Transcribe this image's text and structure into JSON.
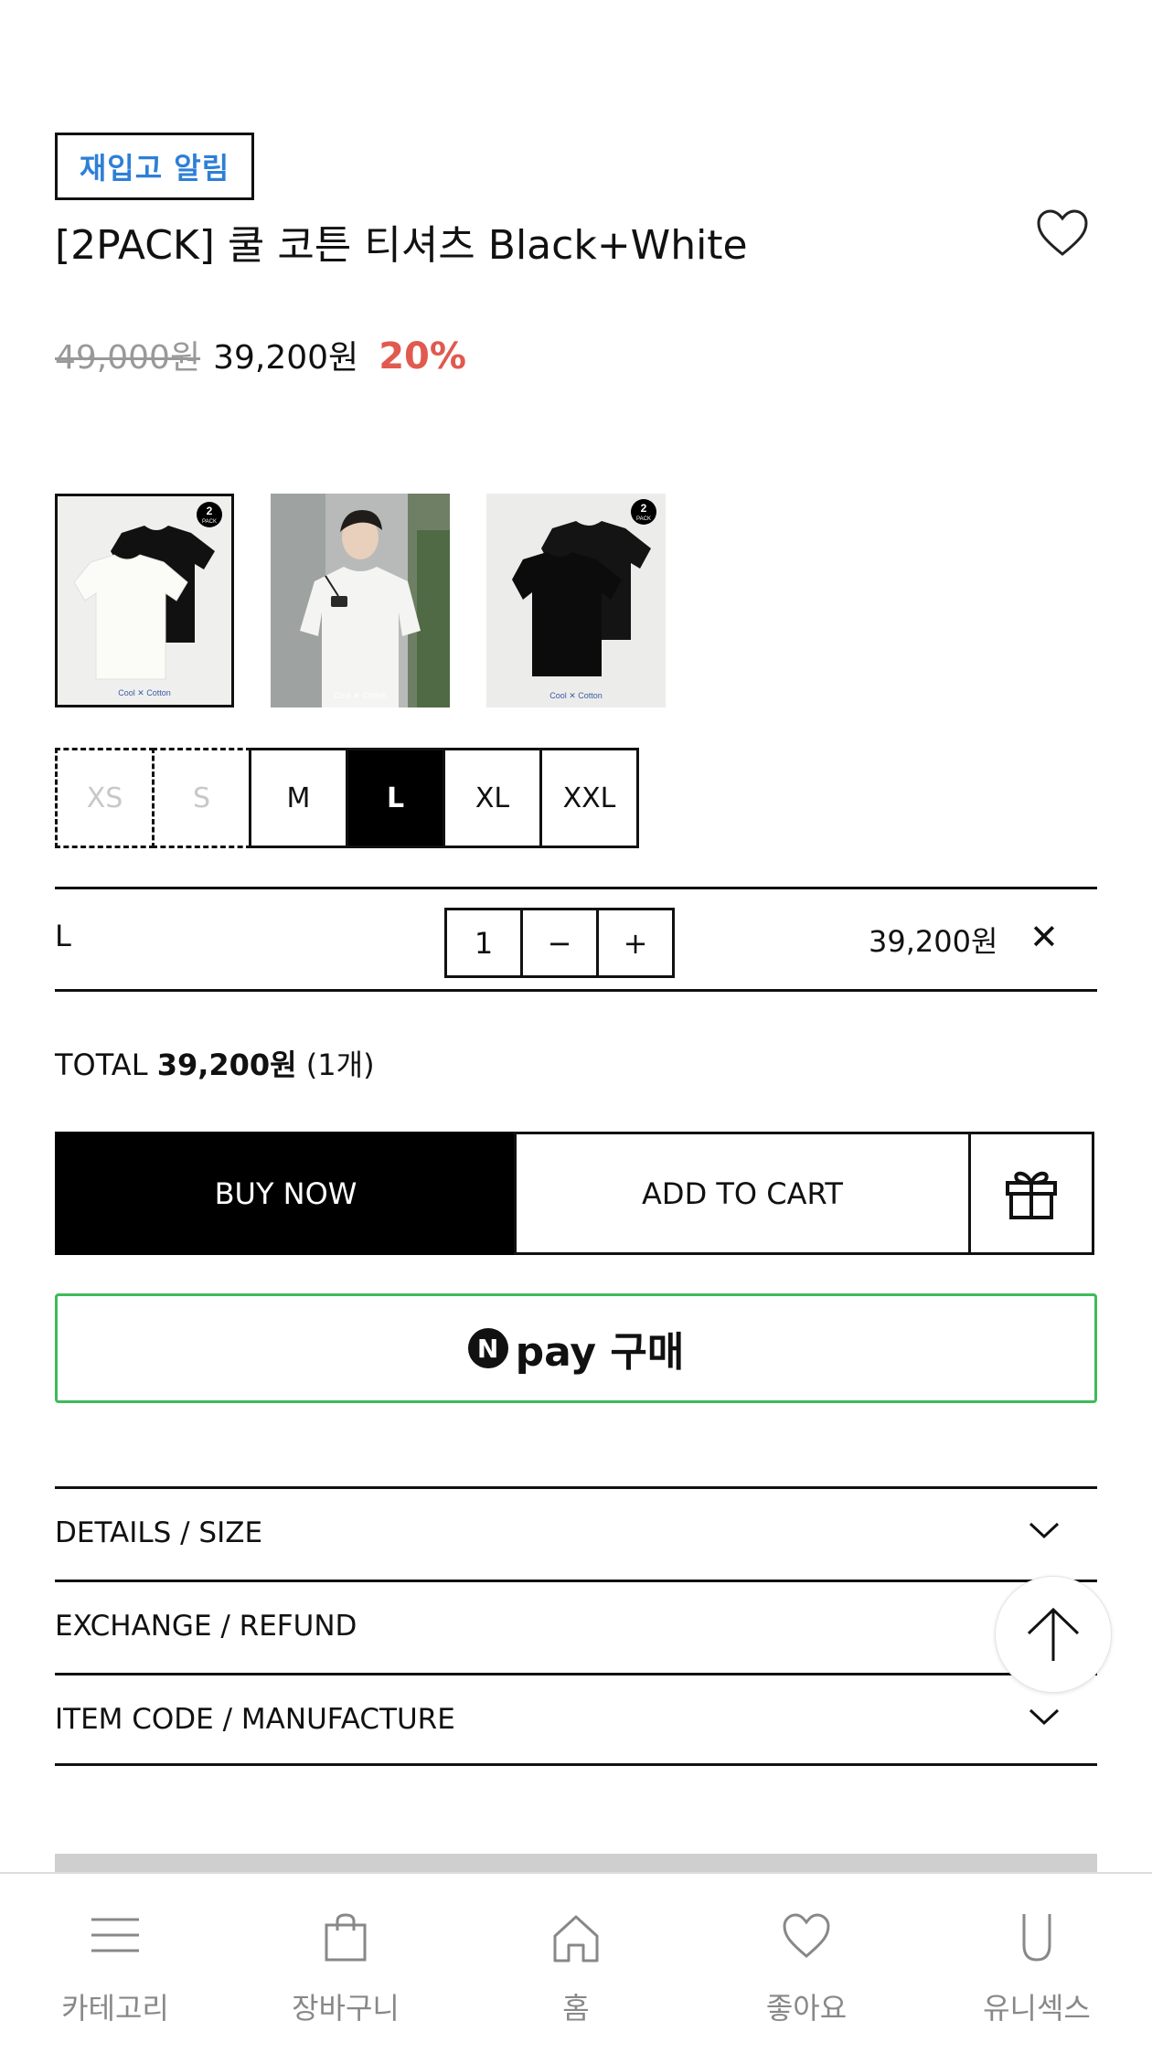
{
  "restock_button": "재입고 알림",
  "product": {
    "title": "[2PACK] 쿨 코튼 티셔츠 Black+White",
    "original_price": "49,000원",
    "sale_price": "39,200원",
    "discount": "20%"
  },
  "thumbnails": [
    {
      "name": "thumb-black-white-pack",
      "badge_num": "2",
      "badge_text": "PACK",
      "caption": "Cool ✕ Cotton",
      "selected": true
    },
    {
      "name": "thumb-model-photo",
      "caption": "Cool ✕ Cotton",
      "selected": false
    },
    {
      "name": "thumb-black-pack",
      "badge_num": "2",
      "badge_text": "PACK",
      "caption": "Cool ✕ Cotton",
      "selected": false
    }
  ],
  "sizes": [
    {
      "label": "XS",
      "state": "out-of-stock"
    },
    {
      "label": "S",
      "state": "out-of-stock"
    },
    {
      "label": "M",
      "state": "available"
    },
    {
      "label": "L",
      "state": "selected"
    },
    {
      "label": "XL",
      "state": "available"
    },
    {
      "label": "XXL",
      "state": "available"
    }
  ],
  "selected_option": {
    "label": "L",
    "quantity": "1",
    "minus": "−",
    "plus": "+",
    "price": "39,200원",
    "remove": "✕"
  },
  "total": {
    "prefix": "TOTAL",
    "amount": "39,200원",
    "count": "(1개)"
  },
  "actions": {
    "buy_now": "BUY NOW",
    "add_to_cart": "ADD TO CART",
    "gift_icon": "gift-icon"
  },
  "npay": {
    "logo_letter": "N",
    "label": "pay 구매",
    "border_color": "#3dbb5a"
  },
  "accordions": [
    {
      "label": "DETAILS / SIZE"
    },
    {
      "label": "EXCHANGE / REFUND"
    },
    {
      "label": "ITEM CODE / MANUFACTURE"
    }
  ],
  "bottom_nav": [
    {
      "label": "카테고리",
      "icon": "menu-icon"
    },
    {
      "label": "장바구니",
      "icon": "bag-icon"
    },
    {
      "label": "홈",
      "icon": "home-icon"
    },
    {
      "label": "좋아요",
      "icon": "heart-icon"
    },
    {
      "label": "유니섹스",
      "icon": "unisex-icon"
    }
  ],
  "colors": {
    "accent_blue": "#2e7fd6",
    "discount_red": "#e05a4f",
    "npay_green": "#3dbb5a"
  }
}
